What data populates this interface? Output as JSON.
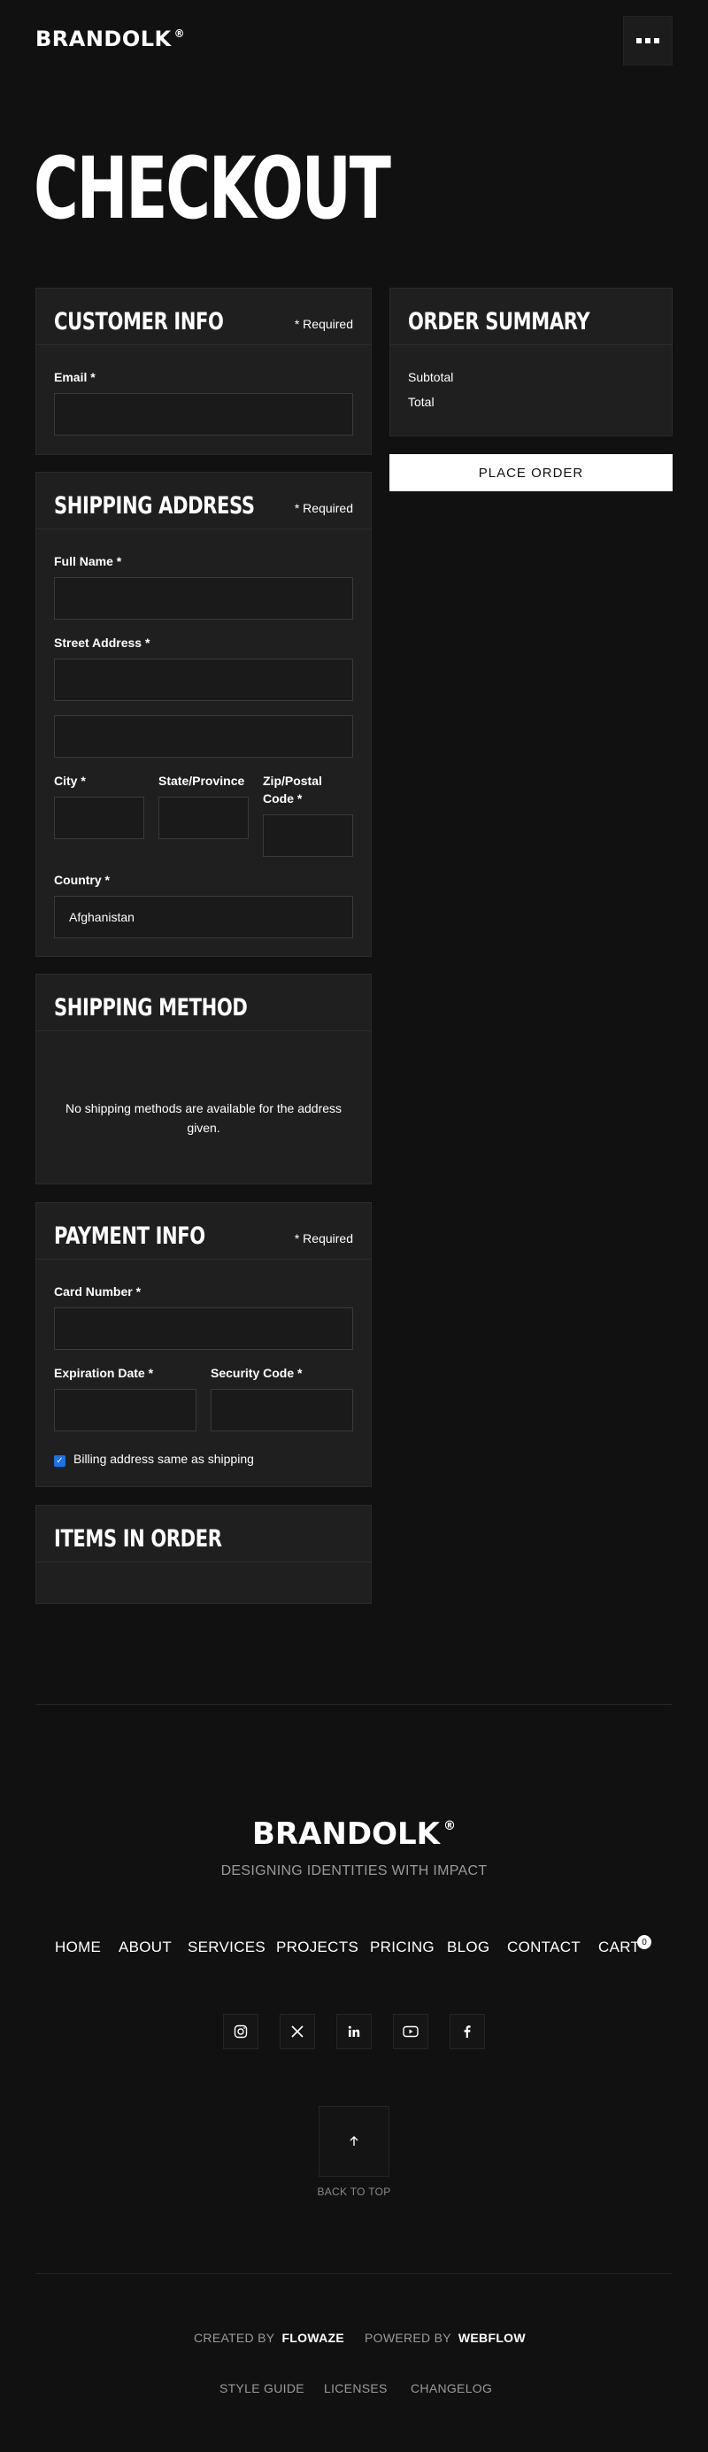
{
  "brand": {
    "name": "BRANDOLK",
    "mark": "®"
  },
  "page": {
    "title": "CHECKOUT"
  },
  "customer_info": {
    "title": "CUSTOMER INFO",
    "required": "* Required",
    "email_label": "Email *",
    "email_value": ""
  },
  "shipping_address": {
    "title": "SHIPPING ADDRESS",
    "required": "* Required",
    "full_name_label": "Full Name *",
    "street_label": "Street Address *",
    "city_label": "City *",
    "state_label": "State/Province",
    "zip_label_line1": "Zip/Postal",
    "zip_label_line2": "Code *",
    "country_label": "Country *",
    "country_value": "Afghanistan"
  },
  "shipping_method": {
    "title": "SHIPPING METHOD",
    "message_line1": "No shipping methods are available for the address",
    "message_line2": "given."
  },
  "payment_info": {
    "title": "PAYMENT INFO",
    "required": "* Required",
    "card_label": "Card Number *",
    "expiry_label": "Expiration Date *",
    "security_label": "Security Code *",
    "billing_checkbox_label": "Billing address same as shipping",
    "billing_checked": true
  },
  "items_in_order": {
    "title": "ITEMS IN ORDER"
  },
  "order_summary": {
    "title": "ORDER SUMMARY",
    "subtotal_label": "Subtotal",
    "total_label": "Total",
    "place_order": "PLACE ORDER"
  },
  "footer": {
    "logo": "BRANDOLK",
    "mark": "®",
    "tagline": "DESIGNING IDENTITIES WITH IMPACT",
    "nav": [
      "HOME",
      "ABOUT",
      "SERVICES",
      "PROJECTS",
      "PRICING",
      "BLOG",
      "CONTACT",
      "CART"
    ],
    "cart_count": "0",
    "socials": [
      "instagram-icon",
      "x-icon",
      "linkedin-icon",
      "youtube-icon",
      "facebook-icon"
    ],
    "back_to_top": "BACK TO TOP",
    "created_by_label": "CREATED BY",
    "created_by": "FLOWAZE",
    "powered_by_label": "POWERED BY",
    "powered_by": "WEBFLOW",
    "links": [
      "STYLE GUIDE",
      "LICENSES",
      "CHANGELOG"
    ]
  },
  "colors": {
    "background": "#111111",
    "card": "#1f1f1f",
    "checkbox": "#1a73e8"
  }
}
